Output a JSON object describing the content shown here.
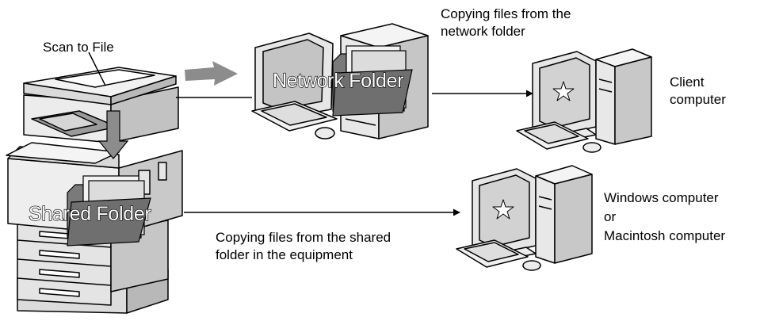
{
  "labels": {
    "scan_to_file": "Scan to File",
    "network_folder": "Network Folder",
    "shared_folder": "Shared Folder",
    "copy_network_1": "Copying files from the",
    "copy_network_2": "network folder",
    "client_1": "Client",
    "client_2": "computer",
    "copy_shared_1": "Copying files from the shared",
    "copy_shared_2": "folder in the equipment",
    "win_1": "Windows computer",
    "win_2": "or",
    "win_3": "Macintosh computer"
  },
  "colors": {
    "line": "#000000",
    "fill_light": "#ececec",
    "fill_mid": "#bdbdbd",
    "fill_dark": "#7a7a7a",
    "arrow_gray": "#8c8c8c",
    "screen": "#d4d4d4"
  },
  "icons": [
    "mfp-copier-icon",
    "network-folder-server-icon",
    "client-computer-icon",
    "windows-mac-computer-icon",
    "folder-icon",
    "arrow-icon"
  ]
}
